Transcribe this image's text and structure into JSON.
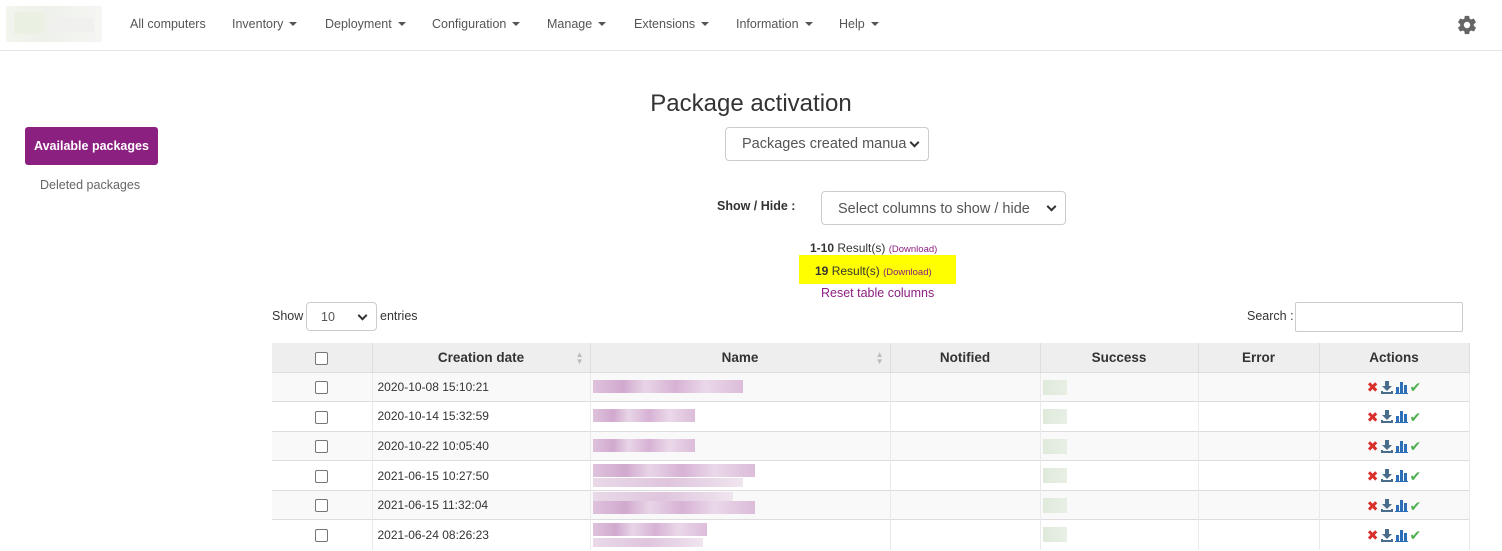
{
  "nav": {
    "items": [
      {
        "label": "All computers",
        "dropdown": false
      },
      {
        "label": "Inventory",
        "dropdown": true
      },
      {
        "label": "Deployment",
        "dropdown": true
      },
      {
        "label": "Configuration",
        "dropdown": true
      },
      {
        "label": "Manage",
        "dropdown": true
      },
      {
        "label": "Extensions",
        "dropdown": true
      },
      {
        "label": "Information",
        "dropdown": true
      },
      {
        "label": "Help",
        "dropdown": true
      }
    ],
    "settings_icon": "gear-icon"
  },
  "sidebar": {
    "active_label": "Available packages",
    "link_label": "Deleted packages",
    "accent_color": "#8c2080"
  },
  "main": {
    "title": "Package activation",
    "package_filter": {
      "selected": "Packages created manua"
    },
    "show_hide": {
      "label": "Show / Hide :",
      "selected": "Select columns to show / hide"
    },
    "results_page": {
      "range": "1-10",
      "text": "Result(s)",
      "download": "(Download)"
    },
    "results_total": {
      "count": "19",
      "text": "Result(s)",
      "download": "(Download)",
      "highlight_color": "#ffff00"
    },
    "reset_label": "Reset table columns",
    "length": {
      "show": "Show",
      "value": "10",
      "entries": "entries"
    },
    "search": {
      "label": "Search :",
      "value": ""
    }
  },
  "table": {
    "columns": [
      "",
      "Creation date",
      "Name",
      "Notified",
      "Success",
      "Error",
      "Actions"
    ],
    "rows": [
      {
        "date": "2020-10-08 15:10:21"
      },
      {
        "date": "2020-10-14 15:32:59"
      },
      {
        "date": "2020-10-22 10:05:40"
      },
      {
        "date": "2021-06-15 10:27:50"
      },
      {
        "date": "2021-06-15 11:32:04"
      },
      {
        "date": "2021-06-24 08:26:23"
      }
    ],
    "action_icons": [
      "delete-icon",
      "download-icon",
      "chart-icon",
      "check-icon"
    ]
  }
}
